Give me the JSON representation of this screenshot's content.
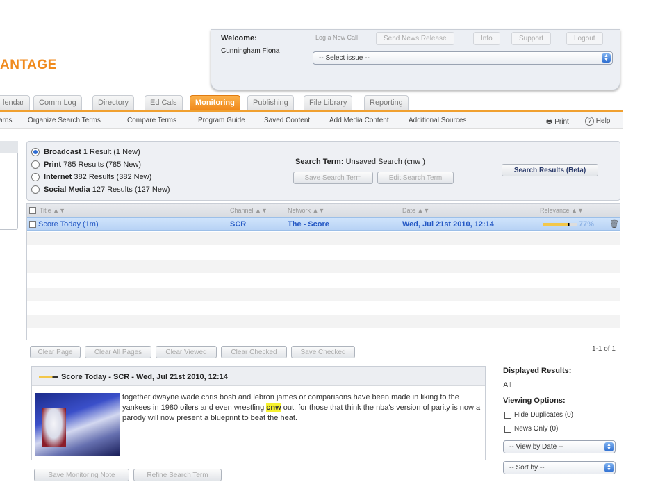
{
  "brand": {
    "logo_text": "ANTAGE"
  },
  "header": {
    "welcome_label": "Welcome:",
    "user_name": "Cunningham Fiona",
    "log_call": "Log a New Call",
    "buttons": [
      "Send News Release",
      "Info",
      "Support",
      "Logout"
    ],
    "issue_select": "-- Select issue --"
  },
  "tabs": [
    "lendar",
    "Comm Log",
    "Directory",
    "Ed Cals",
    "Monitoring",
    "Publishing",
    "File Library",
    "Reporting"
  ],
  "active_tab": "Monitoring",
  "subnav": [
    "arns",
    "Organize Search Terms",
    "Compare Terms",
    "Program Guide",
    "Saved Content",
    "Add Media Content",
    "Additional Sources"
  ],
  "utility": {
    "print": "Print",
    "help": "Help"
  },
  "filters": [
    {
      "label": "Broadcast",
      "detail": "1 Result (1 New)",
      "selected": true
    },
    {
      "label": "Print",
      "detail": "785 Results (785 New)",
      "selected": false
    },
    {
      "label": "Internet",
      "detail": "382 Results (382 New)",
      "selected": false
    },
    {
      "label": "Social Media",
      "detail": "127 Results (127 New)",
      "selected": false
    }
  ],
  "search": {
    "label": "Search Term:",
    "value": "Unsaved Search (cnw )",
    "save_btn": "Save Search Term",
    "edit_btn": "Edit Search Term",
    "results_btn": "Search Results (Beta)"
  },
  "grid": {
    "columns": [
      "Title",
      "Channel",
      "Network",
      "Date",
      "Relevance"
    ],
    "rows": [
      {
        "title": "Score Today (1m)",
        "channel": "SCR",
        "network": "The - Score",
        "date": "Wed, Jul 21st 2010, 12:14",
        "relevance": "77%",
        "relevance_value": 0.77
      }
    ]
  },
  "actions": [
    "Clear Page",
    "Clear All Pages",
    "Clear Viewed",
    "Clear Checked",
    "Save Checked"
  ],
  "count_text": "1-1 of 1",
  "preview": {
    "title": "Score Today - SCR - Wed, Jul 21st 2010, 12:14",
    "text_before": "together dwayne wade chris bosh and lebron james or comparisons have been made in liking to the yankees in 1980 oilers and even wrestling ",
    "highlight": "cnw",
    "text_after": " out. for those that think the nba's version of parity is now a parody will now present a blueprint to beat the heat."
  },
  "bottom_actions": [
    "Save Monitoring Note",
    "Refine Search Term"
  ],
  "side": {
    "displayed_label": "Displayed Results:",
    "displayed_value": "All",
    "viewing_label": "Viewing Options:",
    "hide_dup": "Hide Duplicates (0)",
    "news_only": "News Only (0)",
    "view_by": "-- View by Date --",
    "sort_by": "-- Sort by --"
  }
}
